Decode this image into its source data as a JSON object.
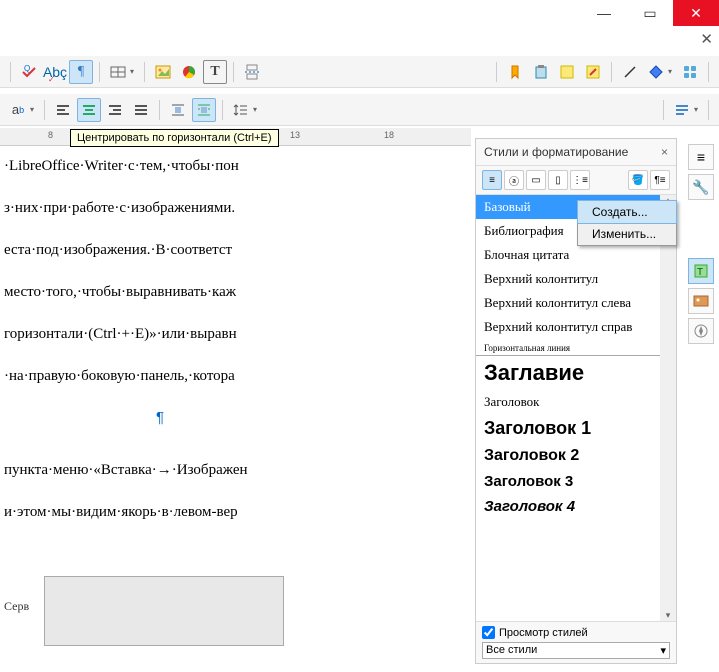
{
  "titlebar": {
    "minimize": "—",
    "maximize": "▭",
    "close": "✕",
    "subclose": "✕"
  },
  "tooltip": "Центрировать по горизонтали (Ctrl+E)",
  "ruler": {
    "marks": [
      "8",
      "13",
      "18"
    ]
  },
  "doc": {
    "lines": [
      "·LibreOffice·Writer·с·тем,·чтобы·пон",
      "з·них·при·работе·с·изображениями.",
      "еста·под·изображения.·В·соответст",
      "место·того,·чтобы·выравнивать·каж",
      "горизонтали·(Ctrl·+·E)»·или·выравн",
      "·на·правую·боковую·панель,·котора",
      "пункта·меню·«Вставка·→·Изображен",
      "и·этом·мы·видим·якорь·в·левом-вер"
    ],
    "serv": "Серв"
  },
  "styles_panel": {
    "title": "Стили и форматирование",
    "items": [
      {
        "label": "Базовый",
        "cls": "sel"
      },
      {
        "label": "Библиография",
        "cls": ""
      },
      {
        "label": "Блочная цитата",
        "cls": ""
      },
      {
        "label": "Верхний колонтитул",
        "cls": ""
      },
      {
        "label": "Верхний колонтитул слева",
        "cls": ""
      },
      {
        "label": "Верхний колонтитул справ",
        "cls": ""
      },
      {
        "label": "Горизонтальная линия",
        "cls": "hr"
      },
      {
        "label": "Заглавие",
        "cls": "big"
      },
      {
        "label": "Заголовок",
        "cls": ""
      },
      {
        "label": "Заголовок 1",
        "cls": "h1"
      },
      {
        "label": "Заголовок 2",
        "cls": "h2"
      },
      {
        "label": "Заголовок 3",
        "cls": "h3"
      },
      {
        "label": "Заголовок 4",
        "cls": "h4"
      }
    ],
    "preview_check": "Просмотр стилей",
    "filter": "Все стили"
  },
  "context_menu": {
    "create": "Создать...",
    "edit": "Изменить..."
  }
}
